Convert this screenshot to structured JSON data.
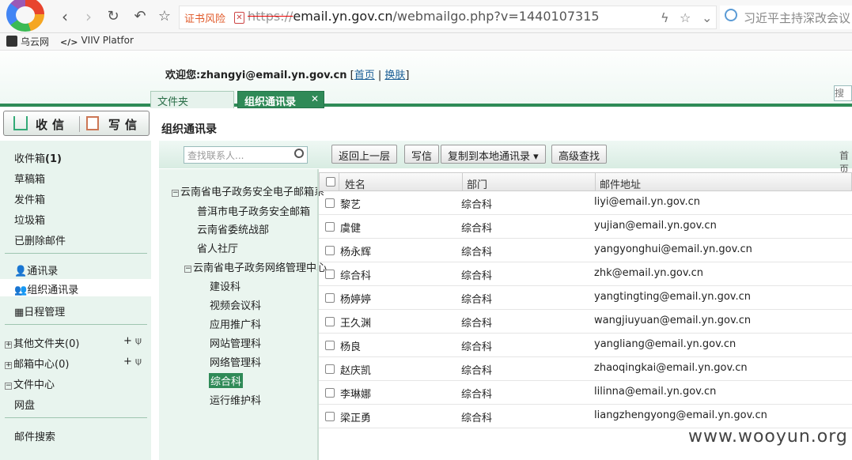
{
  "browser": {
    "cert_warning": "证书风险",
    "url_proto": "https://",
    "url_host": "email.yn.gov.cn",
    "url_path": "/webmailgo.php?v=1440107315",
    "search_text": "习近平主持深改会议",
    "bookmarks": [
      "乌云网",
      "VIIV Platfor"
    ]
  },
  "header": {
    "welcome_prefix": "欢迎您:",
    "user_email": "zhangyi@email.yn.gov.cn",
    "home_link": "首页",
    "skin_link": "换肤",
    "search_box": "搜索"
  },
  "tabs": {
    "folder": "文件夹",
    "org": "组织通讯录",
    "close": "✕"
  },
  "sidebar": {
    "receive": "收信",
    "write": "写信",
    "inbox": "收件箱",
    "inbox_count": "(1)",
    "drafts": "草稿箱",
    "sent": "发件箱",
    "trash": "垃圾箱",
    "deleted": "已删除邮件",
    "contacts": "通讯录",
    "org_contacts": "组织通讯录",
    "calendar": "日程管理",
    "other_folders": "其他文件夹(0)",
    "mail_center": "邮箱中心(0)",
    "file_center": "文件中心",
    "netdisk": "网盘",
    "mail_search": "邮件搜索"
  },
  "main": {
    "title": "组织通讯录",
    "filter_placeholder": "查找联系人...",
    "btn_back": "返回上一层",
    "btn_write": "写信",
    "btn_copy": "复制到本地通讯录",
    "btn_advanced": "高级查找",
    "first_page": "首页"
  },
  "tree": {
    "root": "云南省电子政务安全电子邮箱系",
    "n1": "普洱市电子政务安全邮箱",
    "n2": "云南省委统战部",
    "n3": "省人社厅",
    "n4": "云南省电子政务网络管理中心",
    "c1": "建设科",
    "c2": "视频会议科",
    "c3": "应用推广科",
    "c4": "网站管理科",
    "c5": "网络管理科",
    "c6": "综合科",
    "c7": "运行维护科"
  },
  "grid": {
    "headers": {
      "name": "姓名",
      "dept": "部门",
      "email": "邮件地址"
    },
    "rows": [
      {
        "name": "黎艺",
        "dept": "综合科",
        "email": "liyi@email.yn.gov.cn"
      },
      {
        "name": "虞健",
        "dept": "综合科",
        "email": "yujian@email.yn.gov.cn"
      },
      {
        "name": "杨永辉",
        "dept": "综合科",
        "email": "yangyonghui@email.yn.gov.cn"
      },
      {
        "name": "综合科",
        "dept": "综合科",
        "email": "zhk@email.yn.gov.cn"
      },
      {
        "name": "杨婷婷",
        "dept": "综合科",
        "email": "yangtingting@email.yn.gov.cn"
      },
      {
        "name": "王久渊",
        "dept": "综合科",
        "email": "wangjiuyuan@email.yn.gov.cn"
      },
      {
        "name": "杨良",
        "dept": "综合科",
        "email": "yangliang@email.yn.gov.cn"
      },
      {
        "name": "赵庆凯",
        "dept": "综合科",
        "email": "zhaoqingkai@email.yn.gov.cn"
      },
      {
        "name": "李琳娜",
        "dept": "综合科",
        "email": "lilinna@email.yn.gov.cn"
      },
      {
        "name": "梁正勇",
        "dept": "综合科",
        "email": "liangzhengyong@email.yn.gov.cn"
      }
    ]
  },
  "watermark": "www.wooyun.org"
}
